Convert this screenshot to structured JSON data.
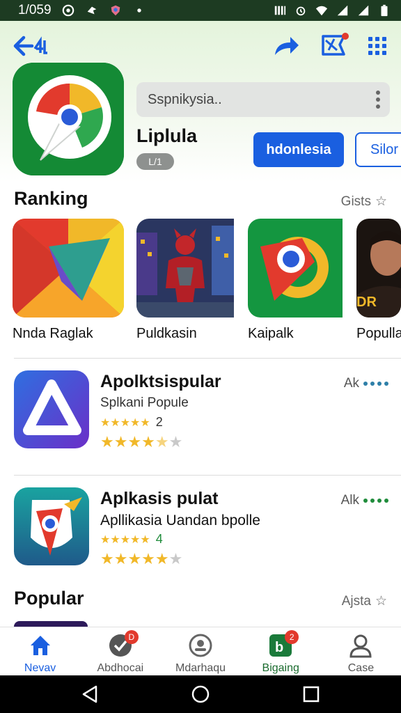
{
  "status_bar": {
    "time": "1/059",
    "icons": [
      "circle-c-icon",
      "bird-icon",
      "shield-icon",
      "dot-icon",
      "vibrate-icon",
      "alarm-icon",
      "wifi-icon",
      "signal-icon",
      "battery-icon"
    ]
  },
  "header": {
    "back_icon": "back-arrow-icon",
    "share_icon": "share-icon",
    "flag_icon": "flag-icon",
    "grid_icon": "grid-icon",
    "search_placeholder": "Sspnikysia..",
    "app_name": "Liplula",
    "app_badge": "L/1",
    "primary_button": "hdonlesia",
    "secondary_button": "Silor"
  },
  "ranking": {
    "title": "Ranking",
    "link": "Gists",
    "items": [
      {
        "label": "Nnda Raglak"
      },
      {
        "label": "Puldkasin"
      },
      {
        "label": "Kaipalk"
      },
      {
        "label": "Populla"
      }
    ]
  },
  "list": [
    {
      "title": "Apolktsispular",
      "subtitle": "Splkani Popule",
      "small_rating": "2",
      "stars": 4.5,
      "action": "Ak"
    },
    {
      "title": "Aplkasis pulat",
      "subtitle": "Apllikasia Uandan bpolle",
      "small_rating": "4",
      "stars": 5,
      "action": "Alk"
    }
  ],
  "popular": {
    "title": "Popular",
    "link": "Ajsta"
  },
  "bottom_nav": {
    "items": [
      {
        "label": "Nevav",
        "badge": ""
      },
      {
        "label": "Abdhocai",
        "badge": "D"
      },
      {
        "label": "Mdarhaqu",
        "badge": ""
      },
      {
        "label": "Bigaing",
        "badge": "2"
      },
      {
        "label": "Case",
        "badge": ""
      }
    ]
  },
  "colors": {
    "accent": "#1a5fe0",
    "brand_green": "#148a35",
    "star": "#f1b829",
    "badge": "#e23a2d"
  }
}
